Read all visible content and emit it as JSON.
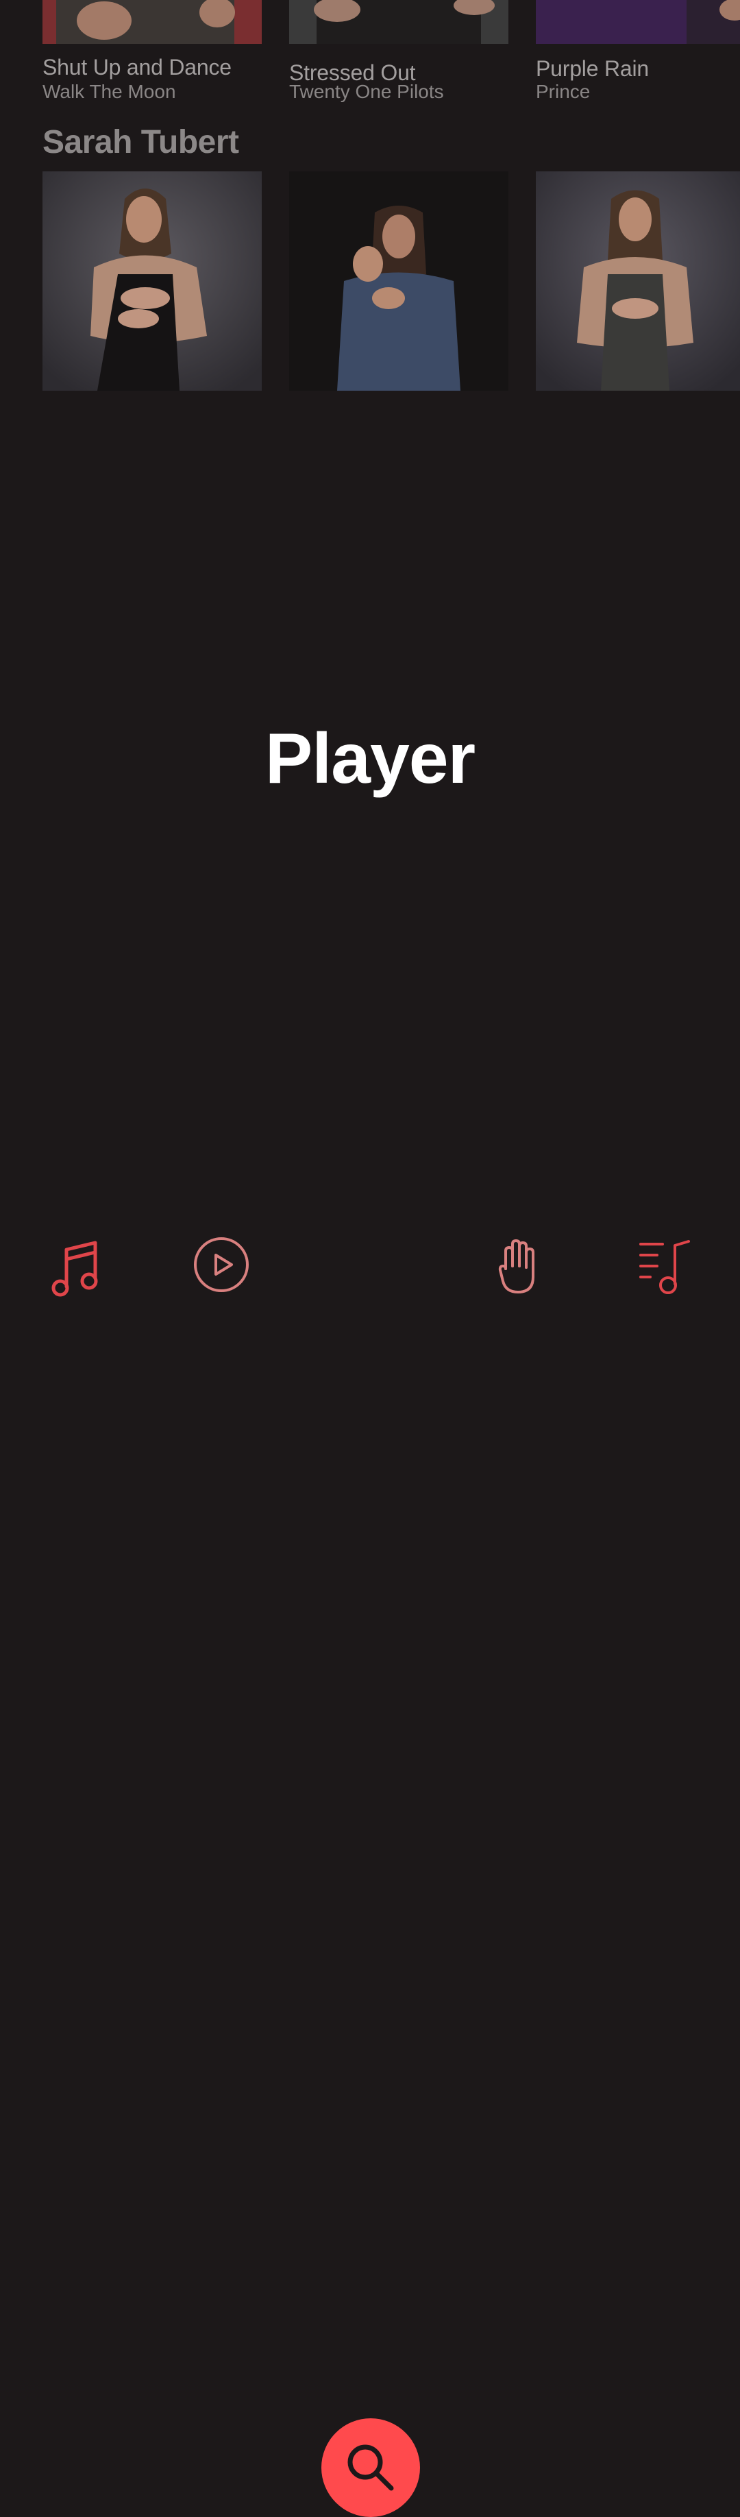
{
  "carousel_top": {
    "items": [
      {
        "title": "Shut Up and Dance",
        "artist": "Walk The Moon"
      },
      {
        "title": "Stressed Out",
        "artist": "Twenty One Pilots"
      },
      {
        "title": "Purple Rain",
        "artist": "Prince"
      }
    ]
  },
  "section": {
    "title": "Sarah Tubert",
    "videos": [
      {
        "label": "interpreter-video-1"
      },
      {
        "label": "interpreter-video-2"
      },
      {
        "label": "interpreter-video-3"
      }
    ]
  },
  "player": {
    "label": "Player"
  },
  "tabbar": {
    "tabs": [
      {
        "name": "music-note-icon"
      },
      {
        "name": "play-circle-icon"
      },
      {
        "name": "search-icon"
      },
      {
        "name": "hand-icon"
      },
      {
        "name": "playlist-icon"
      }
    ]
  },
  "colors": {
    "background": "#1c1819",
    "accent": "#ff4a4d",
    "accent_muted": "#d9807f",
    "text_primary": "#ffffff",
    "text_secondary": "#a39f9f"
  }
}
